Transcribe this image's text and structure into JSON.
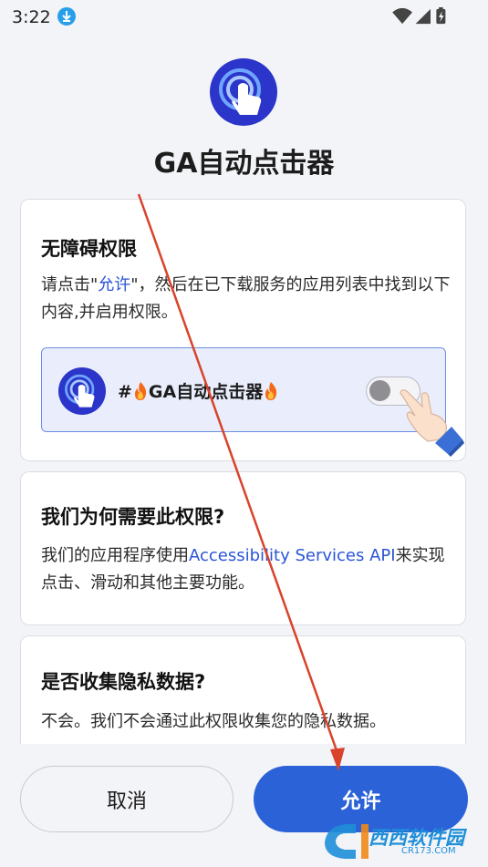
{
  "status_bar": {
    "time": "3:22",
    "icons": [
      "download-icon",
      "wifi-icon",
      "signal-icon",
      "battery-icon"
    ]
  },
  "app": {
    "title": "GA自动点击器",
    "logo_icon": "touch-tap-icon"
  },
  "card_permission": {
    "title": "无障碍权限",
    "text_before": "请点击\"",
    "text_link": "允许",
    "text_after": "\"，然后在已下载服务的应用列表中找到以下内容,并启用权限。",
    "preview": {
      "label_prefix": "#",
      "label_name": "GA自动点击器",
      "toggle_state": "off"
    }
  },
  "card_why": {
    "title": "我们为何需要此权限?",
    "text_before": "我们的应用程序使用",
    "text_link": "Accessibility Services API",
    "text_after": "来实现点击、滑动和其他主要功能。"
  },
  "card_privacy": {
    "title": "是否收集隐私数据?",
    "text": "不会。我们不会通过此权限收集您的隐私数据。"
  },
  "buttons": {
    "cancel": "取消",
    "allow": "允许"
  },
  "watermark": {
    "brand": "西西软件园",
    "site": "CR173.COM"
  },
  "colors": {
    "accent": "#2c62d8",
    "logo": "#2b35c9",
    "arrow": "#d9432b"
  }
}
